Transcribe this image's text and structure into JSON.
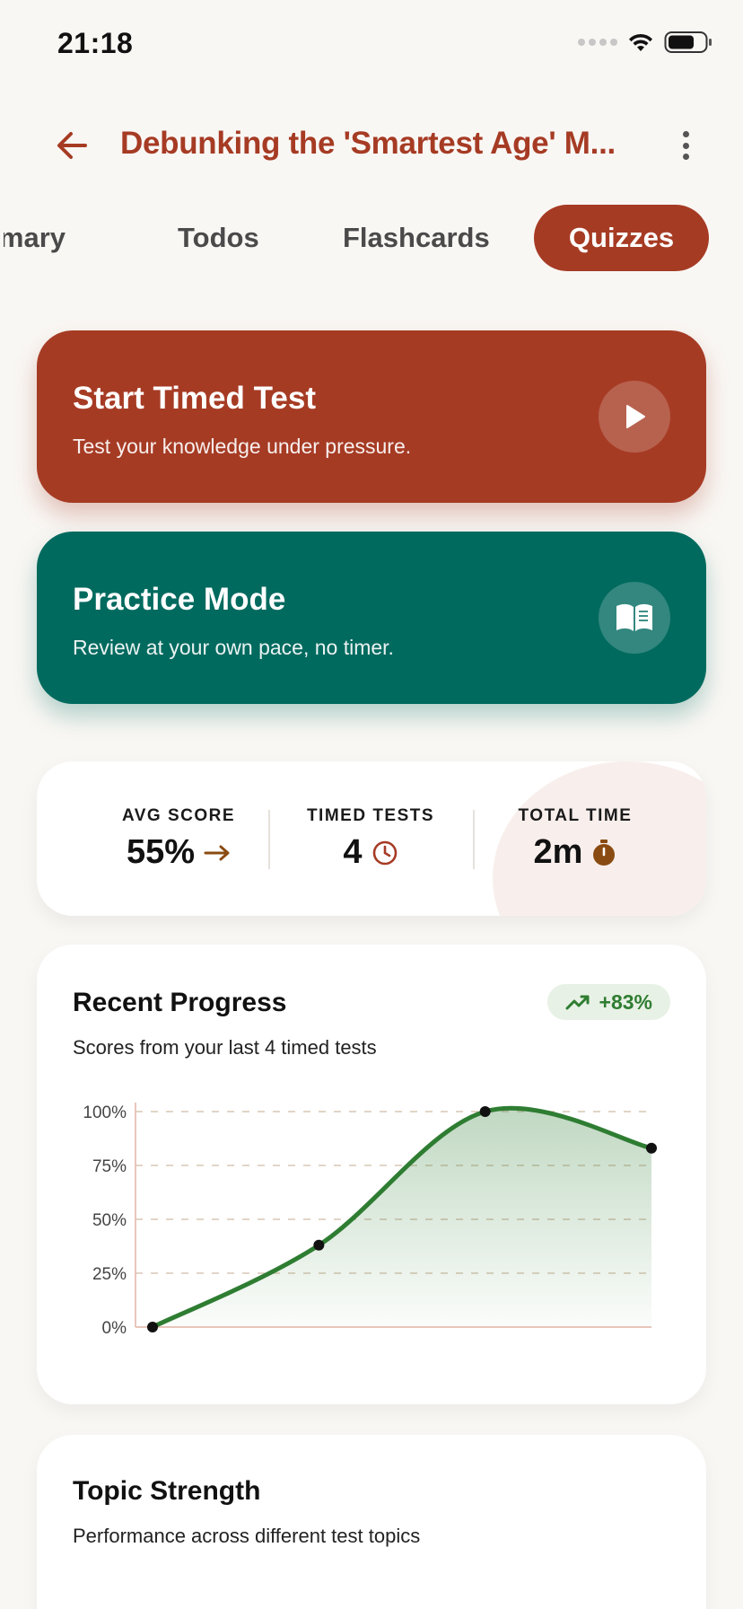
{
  "status_bar": {
    "time": "21:18"
  },
  "header": {
    "title": "Debunking the 'Smartest Age' M..."
  },
  "tabs": [
    {
      "label": "Summary",
      "partial_label": "nmary",
      "active": false
    },
    {
      "label": "Todos",
      "active": false
    },
    {
      "label": "Flashcards",
      "active": false
    },
    {
      "label": "Quizzes",
      "active": true
    }
  ],
  "actions": {
    "timed": {
      "title": "Start Timed Test",
      "subtitle": "Test your knowledge under pressure.",
      "icon": "play-icon",
      "color": "#a63b24"
    },
    "practice": {
      "title": "Practice Mode",
      "subtitle": "Review at your own pace, no timer.",
      "icon": "book-icon",
      "color": "#006a5f"
    }
  },
  "stats": {
    "avg_score": {
      "label": "AVG SCORE",
      "value": "55%",
      "icon": "arrow-right-icon"
    },
    "timed_tests": {
      "label": "TIMED TESTS",
      "value": "4",
      "icon": "clock-icon"
    },
    "total_time": {
      "label": "TOTAL TIME",
      "value": "2m",
      "icon": "stopwatch-icon"
    }
  },
  "progress": {
    "title": "Recent Progress",
    "subtitle": "Scores from your last 4 timed tests",
    "trend": "+83%",
    "trend_icon": "trending-up-icon"
  },
  "chart_data": {
    "type": "area",
    "x": [
      1,
      2,
      3,
      4
    ],
    "values": [
      0,
      38,
      100,
      83
    ],
    "ylim": [
      0,
      100
    ],
    "yticks": [
      "0%",
      "25%",
      "50%",
      "75%",
      "100%"
    ],
    "grid": true,
    "color": "#2e7d32"
  },
  "topic": {
    "title": "Topic Strength",
    "subtitle": "Performance across different test topics"
  },
  "colors": {
    "accent": "#a63b24",
    "teal": "#006a5f",
    "green": "#2e7d32"
  }
}
